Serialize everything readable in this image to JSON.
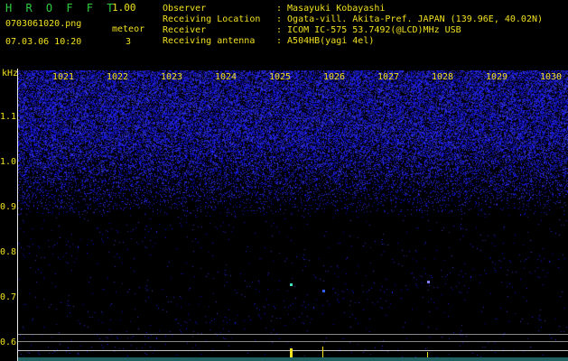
{
  "app": {
    "title": "H R O F F T",
    "version": "1.00"
  },
  "file": {
    "name": "0703061020.png",
    "datetime": "07.03.06 10:20"
  },
  "meteor": {
    "label": "meteor",
    "count": "3"
  },
  "info": [
    {
      "key": "Observer",
      "value": ": Masayuki Kobayashi"
    },
    {
      "key": "Receiving Location",
      "value": ": Ogata-vill. Akita-Pref. JAPAN (139.96E, 40.02N)"
    },
    {
      "key": "Receiver",
      "value": ": ICOM IC-575 53.7492(@LCD)MHz USB"
    },
    {
      "key": "Receiving antenna",
      "value": ": A504HB(yagi 4el)"
    }
  ],
  "axis": {
    "unit": "kHz",
    "top_ticks": [
      "1021",
      "1022",
      "1023",
      "1024",
      "1025",
      "1026",
      "1027",
      "1028",
      "1029",
      "1030"
    ],
    "left_ticks": [
      "1.1",
      "1.0",
      "0.9",
      "0.8",
      "0.7",
      "0.6"
    ]
  },
  "colors": {
    "noise": "#3030c8",
    "text": "#f0e020",
    "title": "#2ecc40",
    "echo": "#40e0c0"
  }
}
